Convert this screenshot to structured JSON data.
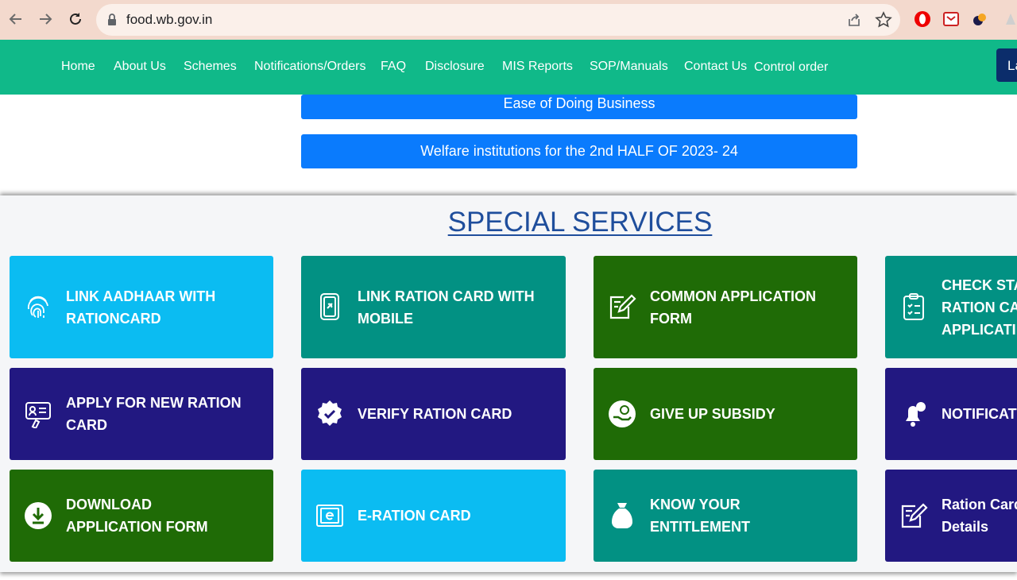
{
  "browser": {
    "url": "food.wb.gov.in"
  },
  "nav": {
    "items": [
      "Home",
      "About Us",
      "Schemes",
      "Notifications/Orders",
      "FAQ",
      "Disclosure",
      "MIS Reports",
      "SOP/Manuals",
      "Contact Us",
      "Control order"
    ],
    "lang_label": "La"
  },
  "banners": {
    "ease": "Ease of Doing Business",
    "welfare": "Welfare institutions for the 2nd HALF OF 2023- 24"
  },
  "services": {
    "title": "SPECIAL SERVICES",
    "tiles": [
      {
        "label": "LINK AADHAAR WITH\nRATIONCARD",
        "icon": "fingerprint-icon",
        "color": "#0bbcf2"
      },
      {
        "label": "LINK RATION CARD WITH\nMOBILE",
        "icon": "mobile-icon",
        "color": "#029183"
      },
      {
        "label": "COMMON APPLICATION\nFORM",
        "icon": "form-edit-icon",
        "color": "#1f6b06"
      },
      {
        "label": "CHECK STA\nRATION CA\nAPPLICATI",
        "icon": "checklist-icon",
        "color": "#029183"
      },
      {
        "label": "APPLY FOR NEW RATION\nCARD",
        "icon": "id-card-icon",
        "color": "#221881"
      },
      {
        "label": "VERIFY RATION CARD",
        "icon": "verified-badge-icon",
        "color": "#221881"
      },
      {
        "label": "GIVE UP SUBSIDY",
        "icon": "hand-coin-icon",
        "color": "#1f6b06"
      },
      {
        "label": "NOTIFICAT",
        "icon": "bell-icon",
        "color": "#221881"
      },
      {
        "label": "DOWNLOAD\nAPPLICATION FORM",
        "icon": "download-icon",
        "color": "#1f6b06"
      },
      {
        "label": "E-RATION CARD",
        "icon": "e-card-icon",
        "color": "#0bbcf2"
      },
      {
        "label": "KNOW YOUR\nENTITLEMENT",
        "icon": "grain-sack-icon",
        "color": "#029183"
      },
      {
        "label": "Ration Card\nDetails",
        "icon": "form-edit-icon",
        "color": "#221881"
      }
    ]
  }
}
